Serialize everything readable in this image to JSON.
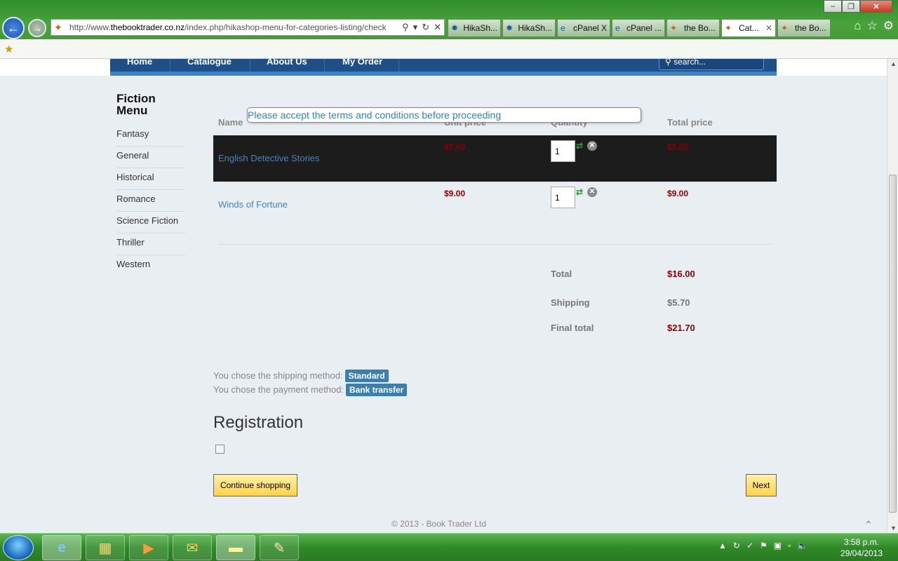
{
  "browser": {
    "url_prefix": "http://www.",
    "url_domain": "thebooktrader.co.nz",
    "url_path": "/index.php/hikashop-menu-for-categories-listing/check",
    "tabs": [
      {
        "label": "HikaSh...",
        "icon": "hikashop-star-icon"
      },
      {
        "label": "HikaSh...",
        "icon": "hikashop-star-icon"
      },
      {
        "label": "cPanel X",
        "icon": "ie-icon"
      },
      {
        "label": "cPanel ...",
        "icon": "ie-icon"
      },
      {
        "label": "the Bo...",
        "icon": "joomla-icon"
      },
      {
        "label": "Cat...",
        "icon": "joomla-icon",
        "active": true
      },
      {
        "label": "the Bo...",
        "icon": "joomla-icon"
      }
    ]
  },
  "site": {
    "menu": [
      "Home",
      "Catalogue",
      "About Us",
      "My Order"
    ],
    "search_placeholder": "search...",
    "sidebar_title": "Fiction Menu",
    "sidebar_items": [
      "Fantasy",
      "General",
      "Historical",
      "Romance",
      "Science Fiction",
      "Thriller",
      "Western"
    ]
  },
  "cart": {
    "tooltip": "Please accept the terms and conditions before proceeding",
    "headers": {
      "name": "Name",
      "unit_price": "Unit price",
      "quantity": "Quantity",
      "total_price": "Total price"
    },
    "items": [
      {
        "name": "English Detective Stories",
        "unit_price": "$7.00",
        "quantity": "1",
        "total": "$7.00"
      },
      {
        "name": "Winds of Fortune",
        "unit_price": "$9.00",
        "quantity": "1",
        "total": "$9.00"
      }
    ],
    "summary": {
      "total_label": "Total",
      "total_value": "$16.00",
      "shipping_label": "Shipping",
      "shipping_value": "$5.70",
      "final_label": "Final total",
      "final_value": "$21.70"
    },
    "shipping_text": "You chose the shipping method:",
    "shipping_method": "Standard",
    "payment_text": "You chose the payment method:",
    "payment_method": "Bank transfer",
    "registration_title": "Registration",
    "continue_label": "Continue shopping",
    "next_label": "Next",
    "footer": "© 2013 - Book Trader Ltd"
  },
  "colors": {
    "price": "#8b0000",
    "link": "#3c86c5",
    "badge": "#3a7fb0",
    "menu_bg": "#1f4f86"
  },
  "taskbar": {
    "time": "3:58 p.m.",
    "date": "29/04/2013"
  }
}
